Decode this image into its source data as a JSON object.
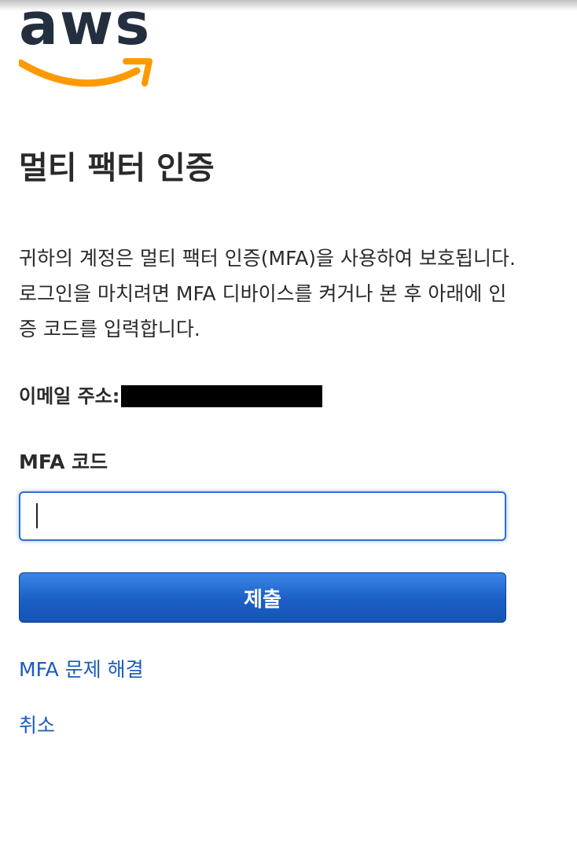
{
  "brand": {
    "logo_text": "aws",
    "logo_color": "#232f3e",
    "smile_color": "#ff9900"
  },
  "page": {
    "title": "멀티 팩터 인증",
    "description": "귀하의 계정은 멀티 팩터 인증(MFA)을 사용하여 보호됩니다. 로그인을 마치려면 MFA 디바이스를 켜거나 본 후 아래에 인증 코드를 입력합니다."
  },
  "account": {
    "email_label": "이메일 주소:"
  },
  "form": {
    "mfa_label": "MFA 코드",
    "mfa_value": "",
    "submit_label": "제출"
  },
  "links": {
    "troubleshoot": "MFA 문제 해결",
    "cancel": "취소"
  },
  "colors": {
    "primary_button": "#1a5fc6",
    "link": "#1a5cb8",
    "focus_border": "#2d6fd0"
  }
}
